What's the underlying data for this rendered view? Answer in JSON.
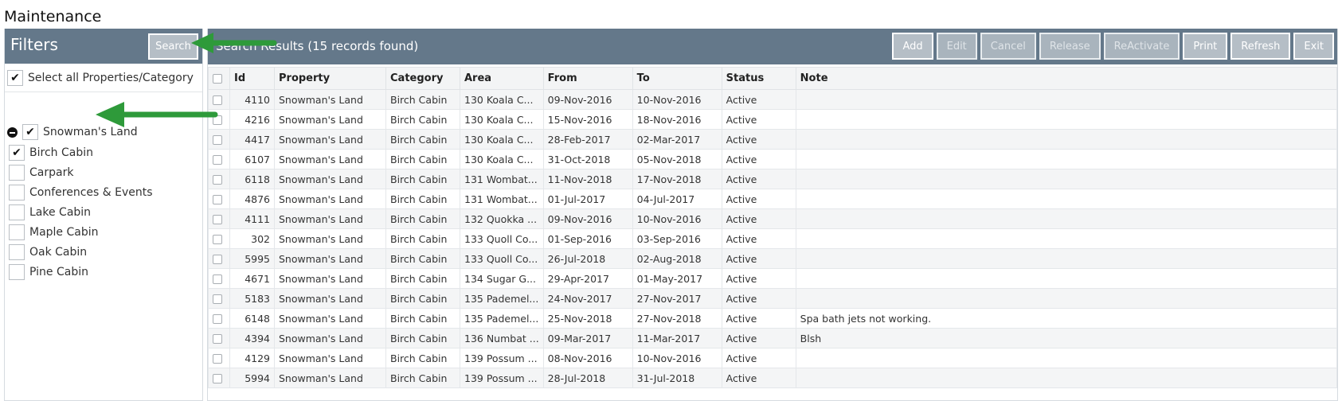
{
  "page": {
    "title": "Maintenance"
  },
  "filters": {
    "title": "Filters",
    "search_label": "Search",
    "select_all_label": "Select all Properties/Category",
    "select_all_checked": true,
    "tree": {
      "root_label": "Snowman's Land",
      "root_checked": true,
      "children": [
        {
          "label": "Birch Cabin",
          "checked": true
        },
        {
          "label": "Carpark",
          "checked": false
        },
        {
          "label": "Conferences & Events",
          "checked": false
        },
        {
          "label": "Lake Cabin",
          "checked": false
        },
        {
          "label": "Maple Cabin",
          "checked": false
        },
        {
          "label": "Oak Cabin",
          "checked": false
        },
        {
          "label": "Pine Cabin",
          "checked": false
        }
      ]
    }
  },
  "results": {
    "title": "Search Results (15 records found)",
    "toolbar": {
      "add": "Add",
      "edit": "Edit",
      "cancel": "Cancel",
      "release": "Release",
      "reactivate": "ReActivate",
      "print": "Print",
      "refresh": "Refresh",
      "exit": "Exit"
    },
    "columns": {
      "id": "Id",
      "property": "Property",
      "category": "Category",
      "area": "Area",
      "from": "From",
      "to": "To",
      "status": "Status",
      "note": "Note"
    },
    "rows": [
      {
        "id": "4110",
        "property": "Snowman's Land",
        "category": "Birch Cabin",
        "area": "130 Koala C...",
        "from": "09-Nov-2016",
        "to": "10-Nov-2016",
        "status": "Active",
        "note": ""
      },
      {
        "id": "4216",
        "property": "Snowman's Land",
        "category": "Birch Cabin",
        "area": "130 Koala C...",
        "from": "15-Nov-2016",
        "to": "18-Nov-2016",
        "status": "Active",
        "note": ""
      },
      {
        "id": "4417",
        "property": "Snowman's Land",
        "category": "Birch Cabin",
        "area": "130 Koala C...",
        "from": "28-Feb-2017",
        "to": "02-Mar-2017",
        "status": "Active",
        "note": ""
      },
      {
        "id": "6107",
        "property": "Snowman's Land",
        "category": "Birch Cabin",
        "area": "130 Koala C...",
        "from": "31-Oct-2018",
        "to": "05-Nov-2018",
        "status": "Active",
        "note": ""
      },
      {
        "id": "6118",
        "property": "Snowman's Land",
        "category": "Birch Cabin",
        "area": "131 Wombat...",
        "from": "11-Nov-2018",
        "to": "17-Nov-2018",
        "status": "Active",
        "note": ""
      },
      {
        "id": "4876",
        "property": "Snowman's Land",
        "category": "Birch Cabin",
        "area": "131 Wombat...",
        "from": "01-Jul-2017",
        "to": "04-Jul-2017",
        "status": "Active",
        "note": ""
      },
      {
        "id": "4111",
        "property": "Snowman's Land",
        "category": "Birch Cabin",
        "area": "132 Quokka ...",
        "from": "09-Nov-2016",
        "to": "10-Nov-2016",
        "status": "Active",
        "note": ""
      },
      {
        "id": "302",
        "property": "Snowman's Land",
        "category": "Birch Cabin",
        "area": "133 Quoll Co...",
        "from": "01-Sep-2016",
        "to": "03-Sep-2016",
        "status": "Active",
        "note": ""
      },
      {
        "id": "5995",
        "property": "Snowman's Land",
        "category": "Birch Cabin",
        "area": "133 Quoll Co...",
        "from": "26-Jul-2018",
        "to": "02-Aug-2018",
        "status": "Active",
        "note": ""
      },
      {
        "id": "4671",
        "property": "Snowman's Land",
        "category": "Birch Cabin",
        "area": "134 Sugar G...",
        "from": "29-Apr-2017",
        "to": "01-May-2017",
        "status": "Active",
        "note": ""
      },
      {
        "id": "5183",
        "property": "Snowman's Land",
        "category": "Birch Cabin",
        "area": "135 Pademel...",
        "from": "24-Nov-2017",
        "to": "27-Nov-2017",
        "status": "Active",
        "note": ""
      },
      {
        "id": "6148",
        "property": "Snowman's Land",
        "category": "Birch Cabin",
        "area": "135 Pademel...",
        "from": "25-Nov-2018",
        "to": "27-Nov-2018",
        "status": "Active",
        "note": "Spa bath jets not working."
      },
      {
        "id": "4394",
        "property": "Snowman's Land",
        "category": "Birch Cabin",
        "area": "136 Numbat ...",
        "from": "09-Mar-2017",
        "to": "11-Mar-2017",
        "status": "Active",
        "note": "Blsh"
      },
      {
        "id": "4129",
        "property": "Snowman's Land",
        "category": "Birch Cabin",
        "area": "139 Possum ...",
        "from": "08-Nov-2016",
        "to": "10-Nov-2016",
        "status": "Active",
        "note": ""
      },
      {
        "id": "5994",
        "property": "Snowman's Land",
        "category": "Birch Cabin",
        "area": "139 Possum ...",
        "from": "28-Jul-2018",
        "to": "31-Jul-2018",
        "status": "Active",
        "note": ""
      }
    ]
  },
  "colors": {
    "header_bg": "#64788a",
    "button_bg": "#b5bec6",
    "arrow": "#2e9a3a"
  },
  "annotations": {
    "arrows": [
      {
        "points_to": "search-button"
      },
      {
        "points_to": "birch-cabin-checkbox"
      }
    ]
  }
}
